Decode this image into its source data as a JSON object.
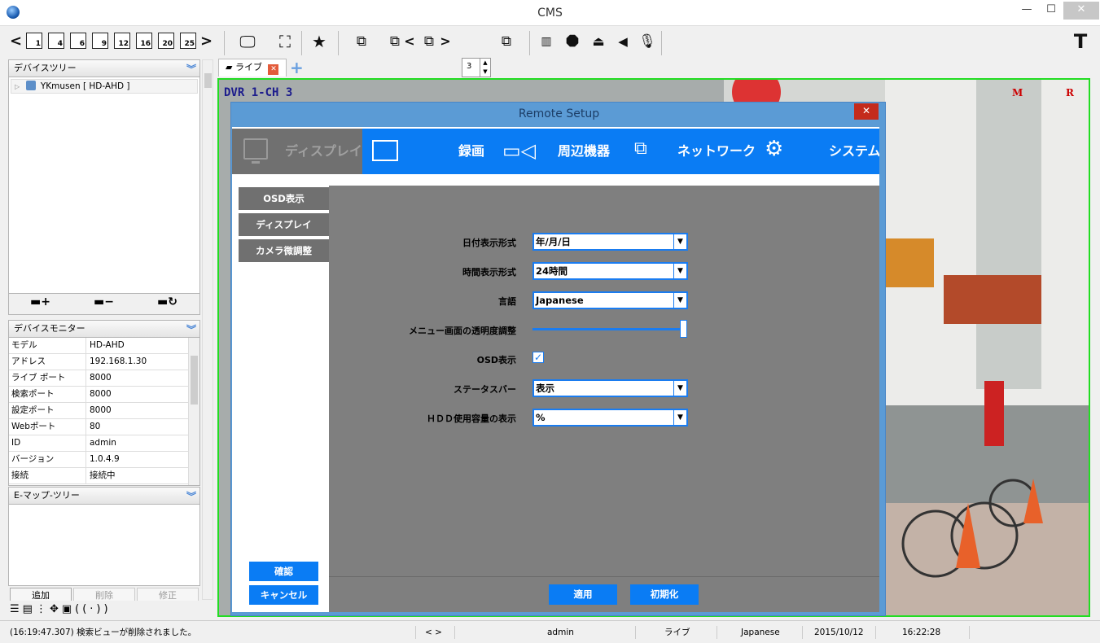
{
  "window": {
    "title": "CMS",
    "min": "—",
    "max": "☐",
    "close": "✕"
  },
  "toolbar": {
    "nav_left": "<",
    "nav_right": ">",
    "layouts": [
      "1",
      "4",
      "6",
      "9",
      "12",
      "16",
      "20",
      "25"
    ],
    "split_value": "3",
    "scroll_prev": "<",
    "scroll_next": ">"
  },
  "device_tree": {
    "header": "デバイスツリー",
    "device": "YKmusen [ HD-AHD ]"
  },
  "device_monitor": {
    "header": "デバイスモニター",
    "rows": [
      {
        "k": "モデル",
        "v": "HD-AHD"
      },
      {
        "k": "アドレス",
        "v": "192.168.1.30"
      },
      {
        "k": "ライブ ポート",
        "v": "8000"
      },
      {
        "k": "検索ポート",
        "v": "8000"
      },
      {
        "k": "設定ポート",
        "v": "8000"
      },
      {
        "k": "Webポート",
        "v": "80"
      },
      {
        "k": "ID",
        "v": "admin"
      },
      {
        "k": "バージョン",
        "v": "1.0.4.9"
      },
      {
        "k": "接続",
        "v": "接続中"
      }
    ]
  },
  "emap": {
    "header": "E-マップ-ツリー",
    "add": "追加",
    "delete": "削除",
    "modify": "修正"
  },
  "live_tab": {
    "label": "ライブ",
    "close": "✕",
    "add": "+"
  },
  "video": {
    "osd": "DVR 1-CH 3",
    "marker_m": "M",
    "marker_r": "R"
  },
  "dialog": {
    "title": "Remote Setup",
    "close": "✕",
    "tabs": [
      "ディスプレイ",
      "録画",
      "周辺機器",
      "ネットワーク",
      "システム"
    ],
    "side_items": [
      "OSD表示",
      "ディスプレイ",
      "カメラ微調整"
    ],
    "confirm": "確認",
    "cancel": "キャンセル",
    "apply": "適用",
    "reset": "初期化",
    "fields": {
      "date_format": {
        "label": "日付表示形式",
        "value": "年/月/日"
      },
      "time_format": {
        "label": "時間表示形式",
        "value": "24時間"
      },
      "language": {
        "label": "言語",
        "value": "Japanese"
      },
      "transparency": {
        "label": "メニュー画面の透明度調整",
        "level": 1.0
      },
      "osd": {
        "label": "OSD表示",
        "checked": true
      },
      "status_bar": {
        "label": "ステータスバー",
        "value": "表示"
      },
      "hdd": {
        "label": "ＨＤＤ使用容量の表示",
        "value": "%"
      }
    }
  },
  "statusbar": {
    "message": "(16:19:47.307) 検索ビューが削除されました。",
    "nav": "<  >",
    "user": "admin",
    "mode": "ライブ",
    "language": "Japanese",
    "date": "2015/10/12",
    "time": "16:22:28"
  }
}
